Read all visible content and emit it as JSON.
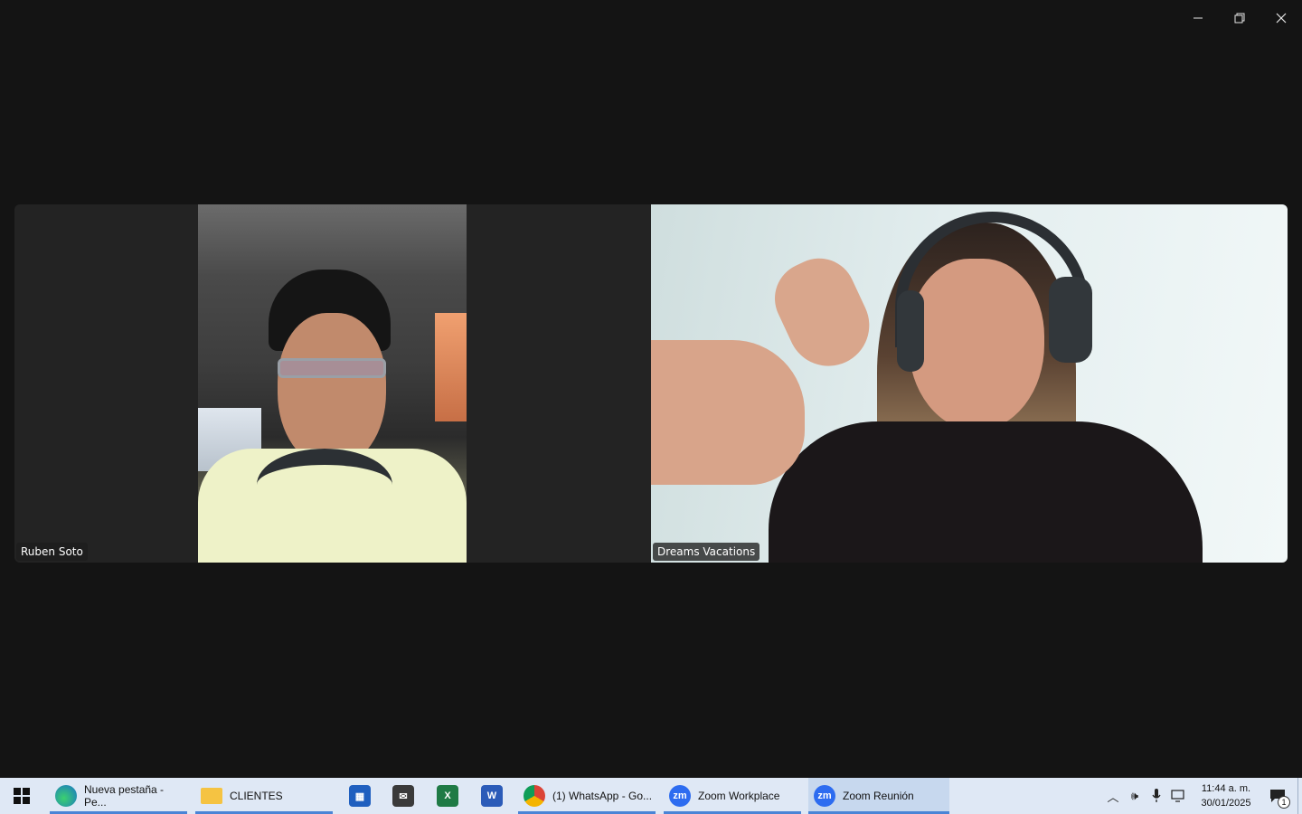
{
  "window": {
    "controls": [
      "minimize",
      "restore",
      "close"
    ]
  },
  "participants": [
    {
      "name": "Ruben Soto"
    },
    {
      "name": "Dreams Vacations"
    }
  ],
  "taskbar": {
    "apps": [
      {
        "label": "Nueva pestaña - Pe...",
        "icon": "edge-icon"
      },
      {
        "label": "CLIENTES",
        "icon": "folder-icon"
      },
      {
        "label": "",
        "icon": "store-icon"
      },
      {
        "label": "",
        "icon": "mail-icon"
      },
      {
        "label": "",
        "icon": "excel-icon"
      },
      {
        "label": "",
        "icon": "word-icon"
      },
      {
        "label": "(1) WhatsApp - Go...",
        "icon": "chrome-icon"
      },
      {
        "label": "Zoom Workplace",
        "icon": "zoom-icon"
      },
      {
        "label": "Zoom Reunión",
        "icon": "zoom-icon"
      }
    ],
    "clock": {
      "time": "11:44 a. m.",
      "date": "30/01/2025"
    },
    "notifications": "1"
  }
}
